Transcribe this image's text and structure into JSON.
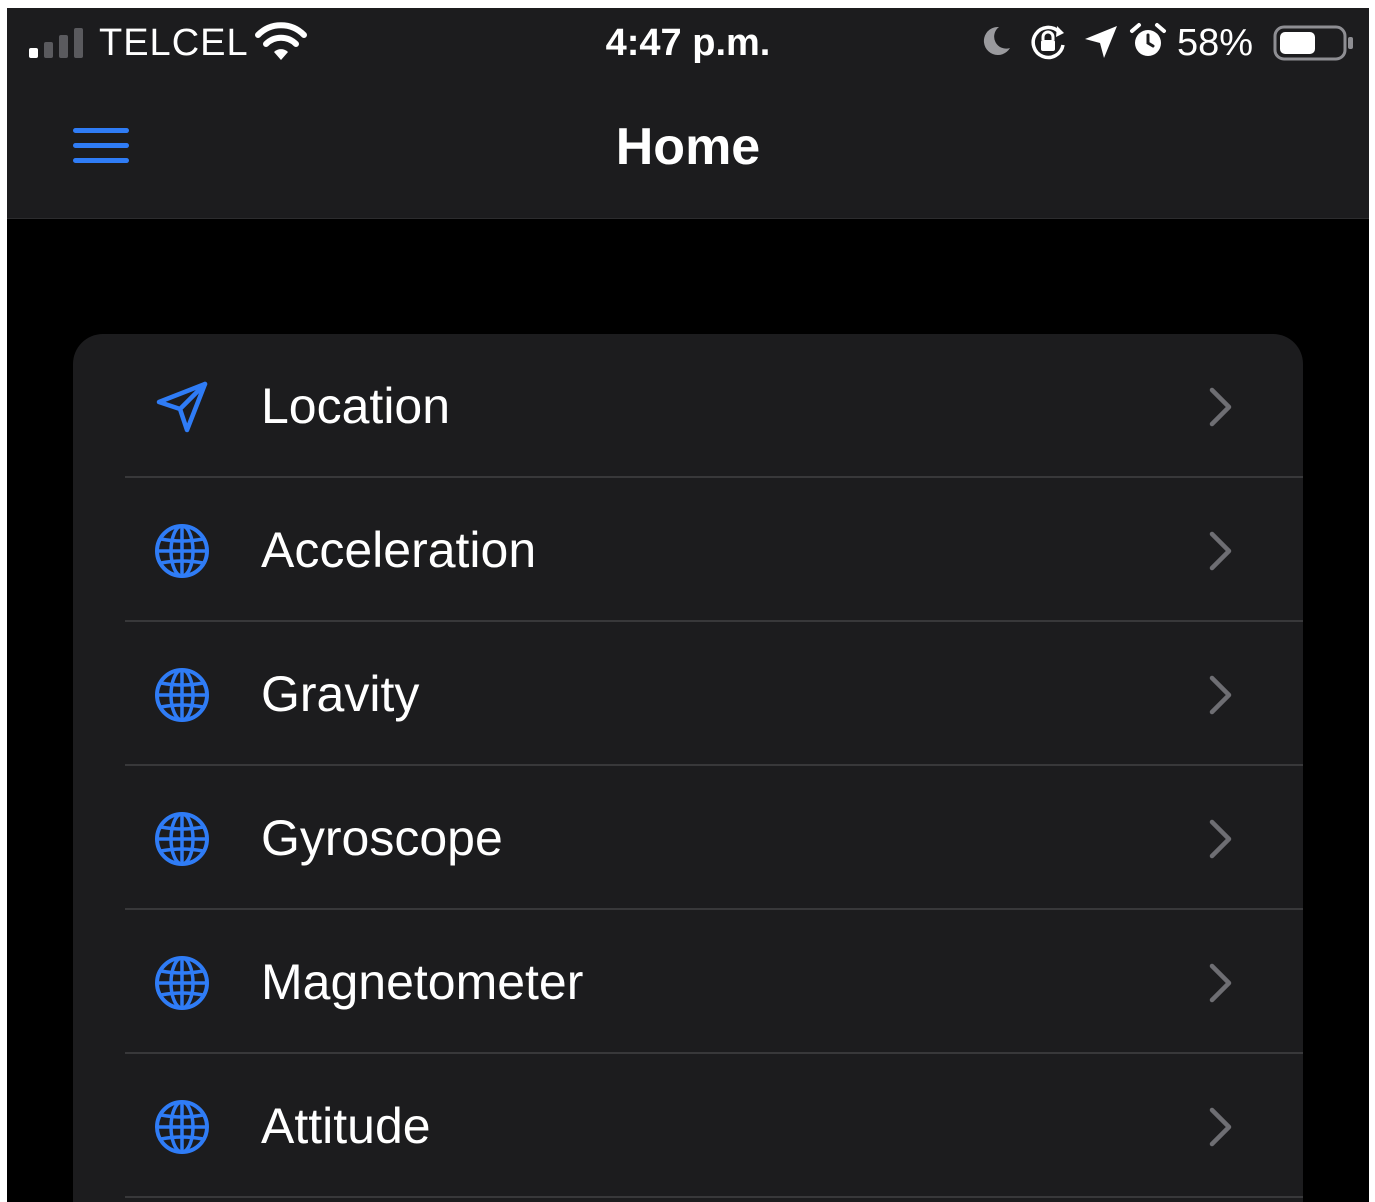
{
  "status_bar": {
    "carrier": "TELCEL",
    "time": "4:47 p.m.",
    "battery_percent": "58%",
    "battery_level": 0.58
  },
  "nav": {
    "title": "Home",
    "menu_icon": "hamburger-menu-icon"
  },
  "colors": {
    "accent": "#2f7cf6",
    "background": "#000000",
    "surface": "#1c1c1e",
    "separator": "#38383a",
    "chevron": "#6e6e73",
    "text": "#ffffff"
  },
  "menu": {
    "items": [
      {
        "label": "Location",
        "icon": "location-arrow-icon"
      },
      {
        "label": "Acceleration",
        "icon": "globe-icon"
      },
      {
        "label": "Gravity",
        "icon": "globe-icon"
      },
      {
        "label": "Gyroscope",
        "icon": "globe-icon"
      },
      {
        "label": "Magnetometer",
        "icon": "globe-icon"
      },
      {
        "label": "Attitude",
        "icon": "globe-icon"
      }
    ]
  }
}
